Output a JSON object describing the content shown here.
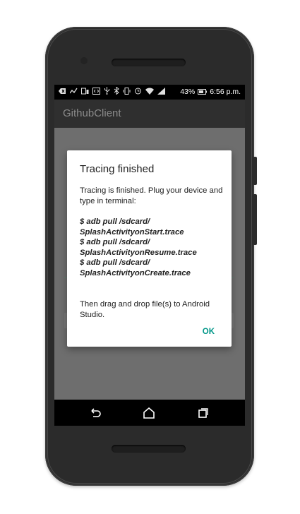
{
  "status_bar": {
    "battery_percent": "43%",
    "time": "6:56 p.m."
  },
  "app": {
    "title": "GithubClient"
  },
  "dialog": {
    "title": "Tracing finished",
    "intro": "Tracing is finished. Plug your device and type in terminal:",
    "commands": [
      "$ adb pull /sdcard/",
      "SplashActivityonStart.trace",
      "$ adb pull /sdcard/",
      "SplashActivityonResume.trace",
      "$ adb pull /sdcard/",
      "SplashActivityonCreate.trace"
    ],
    "footer": "Then drag and drop file(s) to Android Studio.",
    "ok_label": "OK"
  },
  "nav_bar": {
    "back_icon": "back-icon",
    "home_icon": "home-icon",
    "recents_icon": "recents-icon"
  },
  "colors": {
    "accent": "#009688",
    "scrim": "#6e6e6e",
    "appbar": "#2f2f2f"
  }
}
